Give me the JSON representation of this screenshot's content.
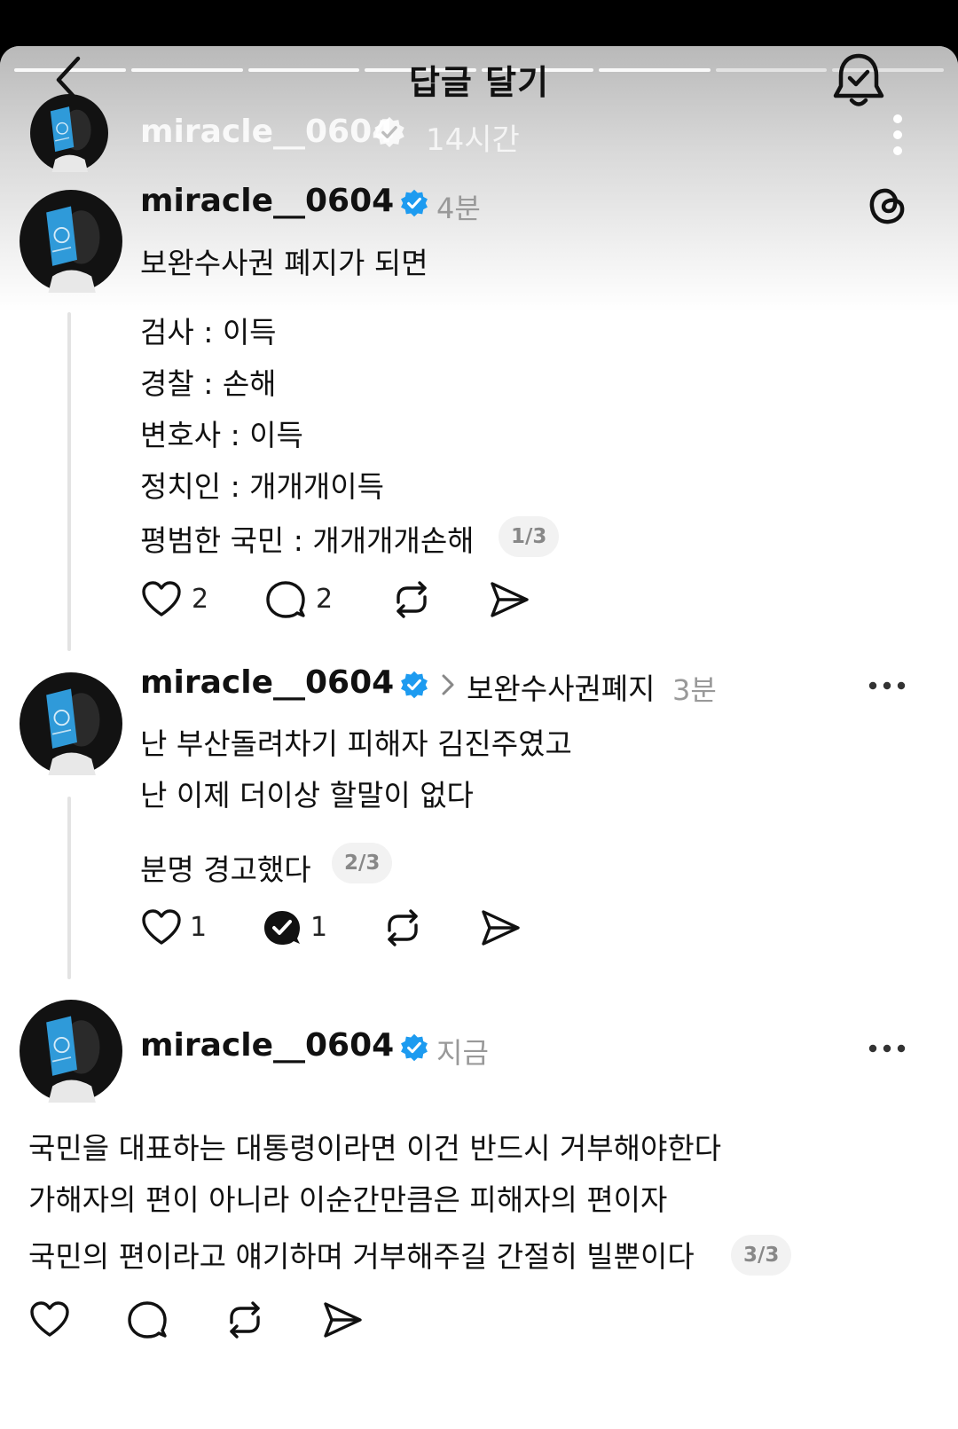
{
  "header": {
    "title": "답글 달기"
  },
  "story": {
    "username": "miracle__0604",
    "time": "14시간"
  },
  "posts": [
    {
      "username": "miracle__0604",
      "time": "4분",
      "lines": [
        "보완수사권 폐지가 되면",
        "검사 : 이득",
        "경찰 : 손해",
        "변호사 : 이득",
        "정치인 : 개개개이득",
        "평범한 국민 : 개개개개손해"
      ],
      "page": "1/3",
      "likes": "2",
      "replies": "2"
    },
    {
      "username": "miracle__0604",
      "topic": "보완수사권폐지",
      "time": "3분",
      "lines": [
        "난 부산돌려차기 피해자 김진주였고",
        "난 이제 더이상 할말이 없다",
        "분명 경고했다"
      ],
      "page": "2/3",
      "likes": "1",
      "replies": "1"
    },
    {
      "username": "miracle__0604",
      "time": "지금",
      "lines": [
        "국민을 대표하는 대통령이라면 이건 반드시 거부해야한다",
        "가해자의 편이 아니라 이순간만큼은 피해자의 편이자",
        "국민의 편이라고 얘기하며 거부해주길 간절히 빌뿐이다"
      ],
      "page": "3/3"
    }
  ],
  "colors": {
    "verified": "#1d9bf0",
    "avatar_book": "#2f9ad9",
    "background": "#ffffff"
  },
  "icons": [
    "back-chevron-icon",
    "bell-check-icon",
    "verified-badge-icon",
    "more-vertical-icon",
    "threads-logo-icon",
    "heart-icon",
    "comment-icon",
    "repost-icon",
    "share-icon",
    "more-horizontal-icon",
    "chevron-right-icon"
  ]
}
